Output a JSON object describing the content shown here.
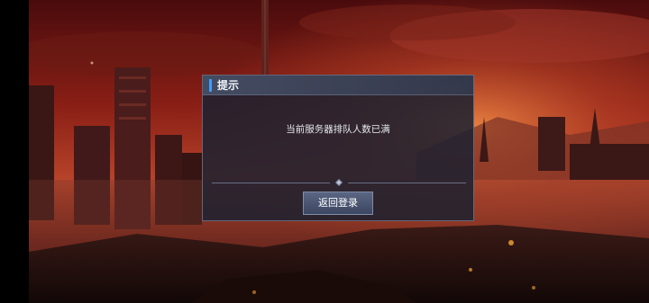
{
  "dialog": {
    "title": "提示",
    "message": "当前服务器排队人数已满",
    "button_label": "返回登录"
  },
  "colors": {
    "accent": "#3f9cff",
    "panel": "#1c2130",
    "sky_top": "#5a0e10",
    "sky_glow": "#d2552a"
  },
  "icons": {
    "divider": "diamond-gem-icon"
  }
}
